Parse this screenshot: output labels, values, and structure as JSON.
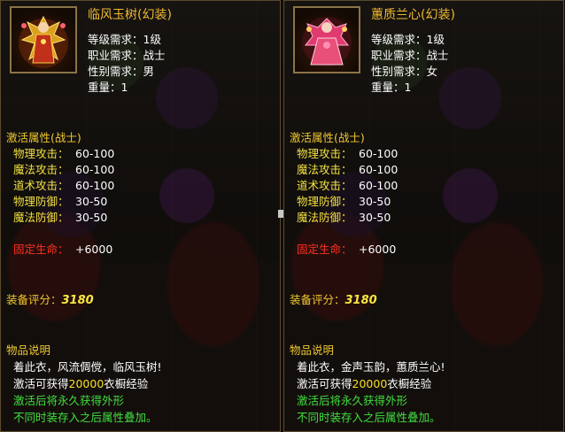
{
  "tooltips": [
    {
      "name": "临风玉树(幻装)",
      "icon": "male-fashion-robe-icon",
      "requirements": [
        {
          "label": "等级需求：",
          "value": "1级"
        },
        {
          "label": "职业需求：",
          "value": "战士"
        },
        {
          "label": "性别需求：",
          "value": "男"
        },
        {
          "label": "重量：",
          "value": "1"
        }
      ],
      "activate_title": "激活属性(战士)",
      "stats": [
        {
          "label": "物理攻击：",
          "value": "60-100"
        },
        {
          "label": "魔法攻击：",
          "value": "60-100"
        },
        {
          "label": "道术攻击：",
          "value": "60-100"
        },
        {
          "label": "物理防御：",
          "value": "30-50"
        },
        {
          "label": "魔法防御：",
          "value": "30-50"
        }
      ],
      "fixed_hp_label": "固定生命：",
      "fixed_hp_value": "+6000",
      "score_label": "装备评分：",
      "score_value": "3180",
      "desc_title": "物品说明",
      "desc_flavor": "着此衣，风流倜傥，临风玉树!",
      "desc_exp_prefix": "激活可获得",
      "desc_exp_amount": "20000",
      "desc_exp_suffix": "衣橱经验",
      "desc_line3": "激活后将永久获得外形",
      "desc_line4": "不同时装存入之后属性叠加。"
    },
    {
      "name": "蕙质兰心(幻装)",
      "icon": "female-fashion-dress-icon",
      "requirements": [
        {
          "label": "等级需求：",
          "value": "1级"
        },
        {
          "label": "职业需求：",
          "value": "战士"
        },
        {
          "label": "性别需求：",
          "value": "女"
        },
        {
          "label": "重量：",
          "value": "1"
        }
      ],
      "activate_title": "激活属性(战士)",
      "stats": [
        {
          "label": "物理攻击：",
          "value": "60-100"
        },
        {
          "label": "魔法攻击：",
          "value": "60-100"
        },
        {
          "label": "道术攻击：",
          "value": "60-100"
        },
        {
          "label": "物理防御：",
          "value": "30-50"
        },
        {
          "label": "魔法防御：",
          "value": "30-50"
        }
      ],
      "fixed_hp_label": "固定生命：",
      "fixed_hp_value": "+6000",
      "score_label": "装备评分：",
      "score_value": "3180",
      "desc_title": "物品说明",
      "desc_flavor": "着此衣，金声玉韵，蕙质兰心!",
      "desc_exp_prefix": "激活可获得",
      "desc_exp_amount": "20000",
      "desc_exp_suffix": "衣橱经验",
      "desc_line3": "激活后将永久获得外形",
      "desc_line4": "不同时装存入之后属性叠加。"
    }
  ],
  "colors": {
    "title": "#f0b830",
    "section": "#f0c830",
    "stat_label": "#f0e040",
    "hp_label": "#ff3020",
    "score": "#f8e840",
    "green": "#40e040"
  }
}
